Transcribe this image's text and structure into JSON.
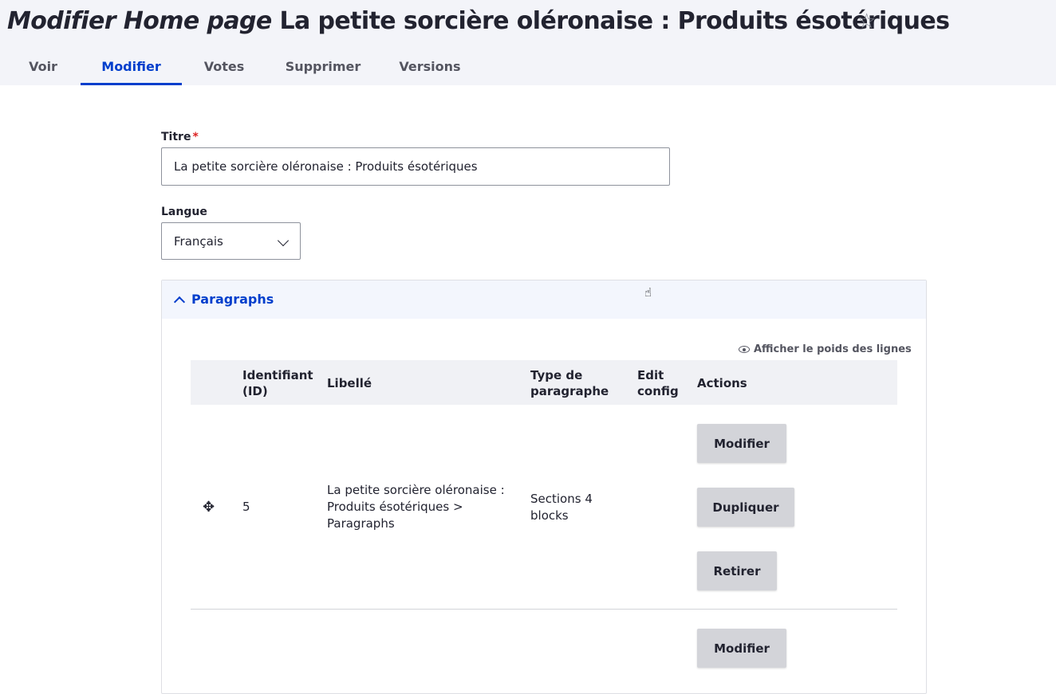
{
  "header": {
    "title_prefix": "Modifier Home page",
    "title_main": "La petite sorcière oléronaise : Produits ésotériques",
    "star_icon": "☆"
  },
  "tabs": [
    {
      "label": "Voir",
      "active": false
    },
    {
      "label": "Modifier",
      "active": true
    },
    {
      "label": "Votes",
      "active": false
    },
    {
      "label": "Supprimer",
      "active": false
    },
    {
      "label": "Versions",
      "active": false
    }
  ],
  "form": {
    "title_label": "Titre",
    "required_mark": "*",
    "title_value": "La petite sorcière oléronaise : Produits ésotériques",
    "language_label": "Langue",
    "language_value": "Français"
  },
  "paragraphs": {
    "summary": "Paragraphs",
    "show_weights": "Afficher le poids des lignes",
    "columns": {
      "id": "Identifiant (ID)",
      "label": "Libellé",
      "type": "Type de paragraphe",
      "edit_config": "Edit config",
      "actions": "Actions"
    },
    "rows": [
      {
        "drag_icon": "✥",
        "id": "5",
        "label": "La petite sorcière oléronaise : Produits ésotériques > Paragraphs",
        "type": "Sections 4 blocks",
        "edit_config": "",
        "buttons": {
          "edit": "Modifier",
          "duplicate": "Dupliquer",
          "remove": "Retirer"
        }
      },
      {
        "buttons": {
          "edit": "Modifier"
        }
      }
    ]
  },
  "cursor_icon": "☝"
}
